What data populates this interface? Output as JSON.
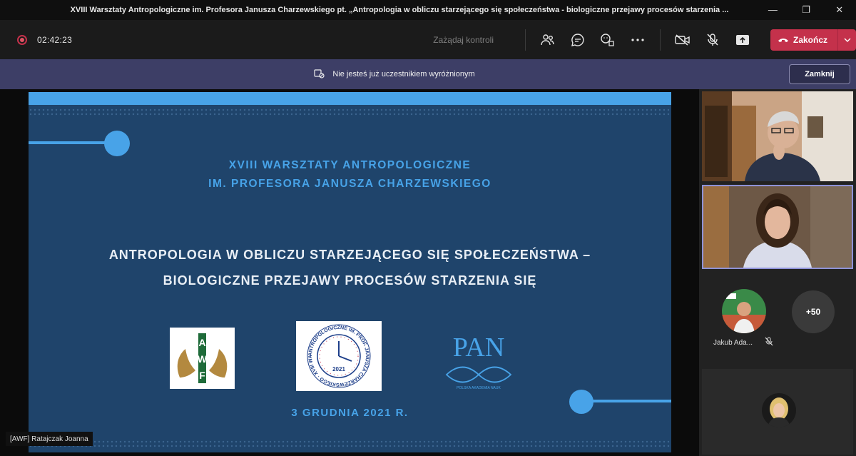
{
  "window": {
    "title": "XVIII Warsztaty Antropologiczne im. Profesora Janusza Charzewskiego pt. „Antropologia w obliczu starzejącego się społeczeństwa - biologiczne przejawy procesów starzenia ...",
    "minimize_icon": "minimize-icon",
    "maximize_icon": "maximize-icon",
    "close_icon": "close-icon"
  },
  "toolbar": {
    "timer": "02:42:23",
    "request_control": "Zażądaj kontroli",
    "end_label": "Zakończ",
    "colors": {
      "end": "#c4314b"
    }
  },
  "notice": {
    "text": "Nie jesteś już uczestnikiem wyróżnionym",
    "close_label": "Zamknij"
  },
  "slide": {
    "workshop_line1": "XVIII WARSZTATY ANTROPOLOGICZNE",
    "workshop_line2": "IM. PROFESORA JANUSZA CHARZEWSKIEGO",
    "title_line1": "ANTROPOLOGIA W OBLICZU STARZEJĄCEGO SIĘ SPOŁECZEŃSTWA –",
    "title_line2": "BIOLOGICZNE PRZEJAWY PROCESÓW STARZENIA SIĘ",
    "date": "3 GRUDNIA 2021 R.",
    "logos": {
      "awf": "AWF",
      "ring_text": "ANTROPOLOGICZNE IM. PROF. JANUSZA CHARZEWSKIEGO · XVIII WARSZTATY",
      "ring_year": "2021",
      "pan": "PAN",
      "pan_sub": "POLSKA AKADEMIA NAUK"
    },
    "colors": {
      "background": "#1f446b",
      "accent": "#48a3e8",
      "title": "#e8eef5"
    }
  },
  "presenter_label": "[AWF] Ratajczak Joanna",
  "participants": {
    "more_count": "+50",
    "third_name": "Jakub Ada..."
  }
}
